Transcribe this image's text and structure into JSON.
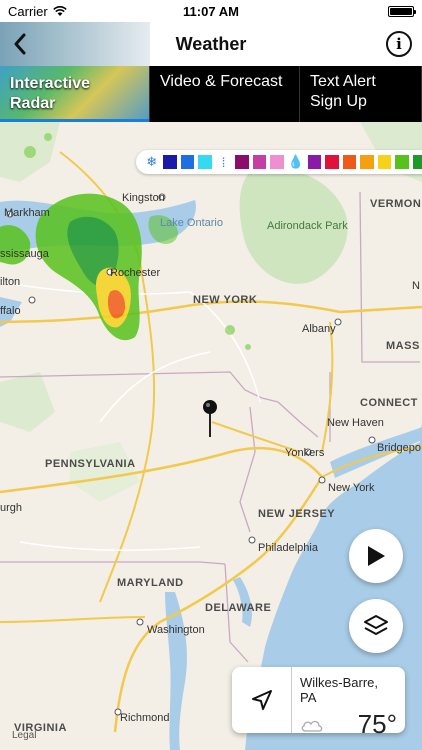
{
  "status_bar": {
    "carrier": "Carrier",
    "time": "11:07 AM"
  },
  "nav": {
    "title": "Weather",
    "info_glyph": "i"
  },
  "tabs": [
    {
      "label": "Interactive Radar",
      "active": true
    },
    {
      "label": "Video & Forecast",
      "active": false
    },
    {
      "label": "Text Alert Sign Up",
      "active": false
    }
  ],
  "legend": {
    "snow_icon": "snowflake-icon",
    "ice_icon": "sleet-icon",
    "rain_icon": "raindrop-icon",
    "snow_colors": [
      "#1a1aa8",
      "#1e6fe0",
      "#35d9f2"
    ],
    "ice_colors": [
      "#8b0f6a",
      "#c43fa4",
      "#ee8fd2"
    ],
    "rain_colors": [
      "#8a1aa8",
      "#e0113a",
      "#f05a18",
      "#f5a011",
      "#f6d21a",
      "#57c21c",
      "#1f9a2a"
    ]
  },
  "map": {
    "states": [
      "NEW YORK",
      "PENNSYLVANIA",
      "NEW JERSEY",
      "MARYLAND",
      "DELAWARE",
      "VIRGINIA",
      "VERMON",
      "MASS",
      "CONNECT"
    ],
    "cities": [
      "Markham",
      "Kingston",
      "Lake Ontario",
      "ssissauga",
      "Rochester",
      "ilton",
      "ffalo",
      "Adirondack Park",
      "Albany",
      "Yonkers",
      "New Haven",
      "Bridgepo",
      "New York",
      "Philadelphia",
      "Washington",
      "Richmond",
      "urgh",
      "N"
    ],
    "legal_label": "Legal"
  },
  "location_card": {
    "city": "Wilkes-Barre, PA",
    "temperature": "75°"
  },
  "colors": {
    "accent": "#1a7fd6",
    "water": "#a9cde8",
    "land": "#f3efe6",
    "park": "#cfe5c0"
  }
}
